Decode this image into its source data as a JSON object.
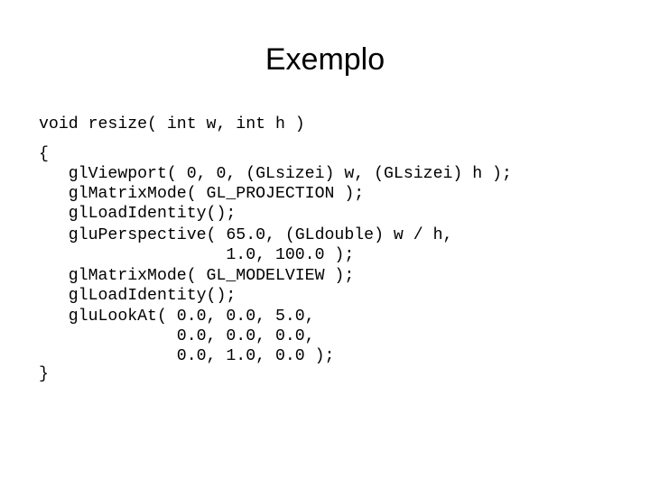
{
  "slide": {
    "title": "Exemplo",
    "code": {
      "signature": "void resize( int w, int h )",
      "open_brace": "{",
      "lines": [
        "   glViewport( 0, 0, (GLsizei) w, (GLsizei) h );",
        "   glMatrixMode( GL_PROJECTION );",
        "   glLoadIdentity();",
        "   gluPerspective( 65.0, (GLdouble) w / h,",
        "                   1.0, 100.0 );",
        "   glMatrixMode( GL_MODELVIEW );",
        "   glLoadIdentity();",
        "   gluLookAt( 0.0, 0.0, 5.0,",
        "              0.0, 0.0, 0.0,",
        "              0.0, 1.0, 0.0 );"
      ],
      "close_brace": "}"
    }
  }
}
